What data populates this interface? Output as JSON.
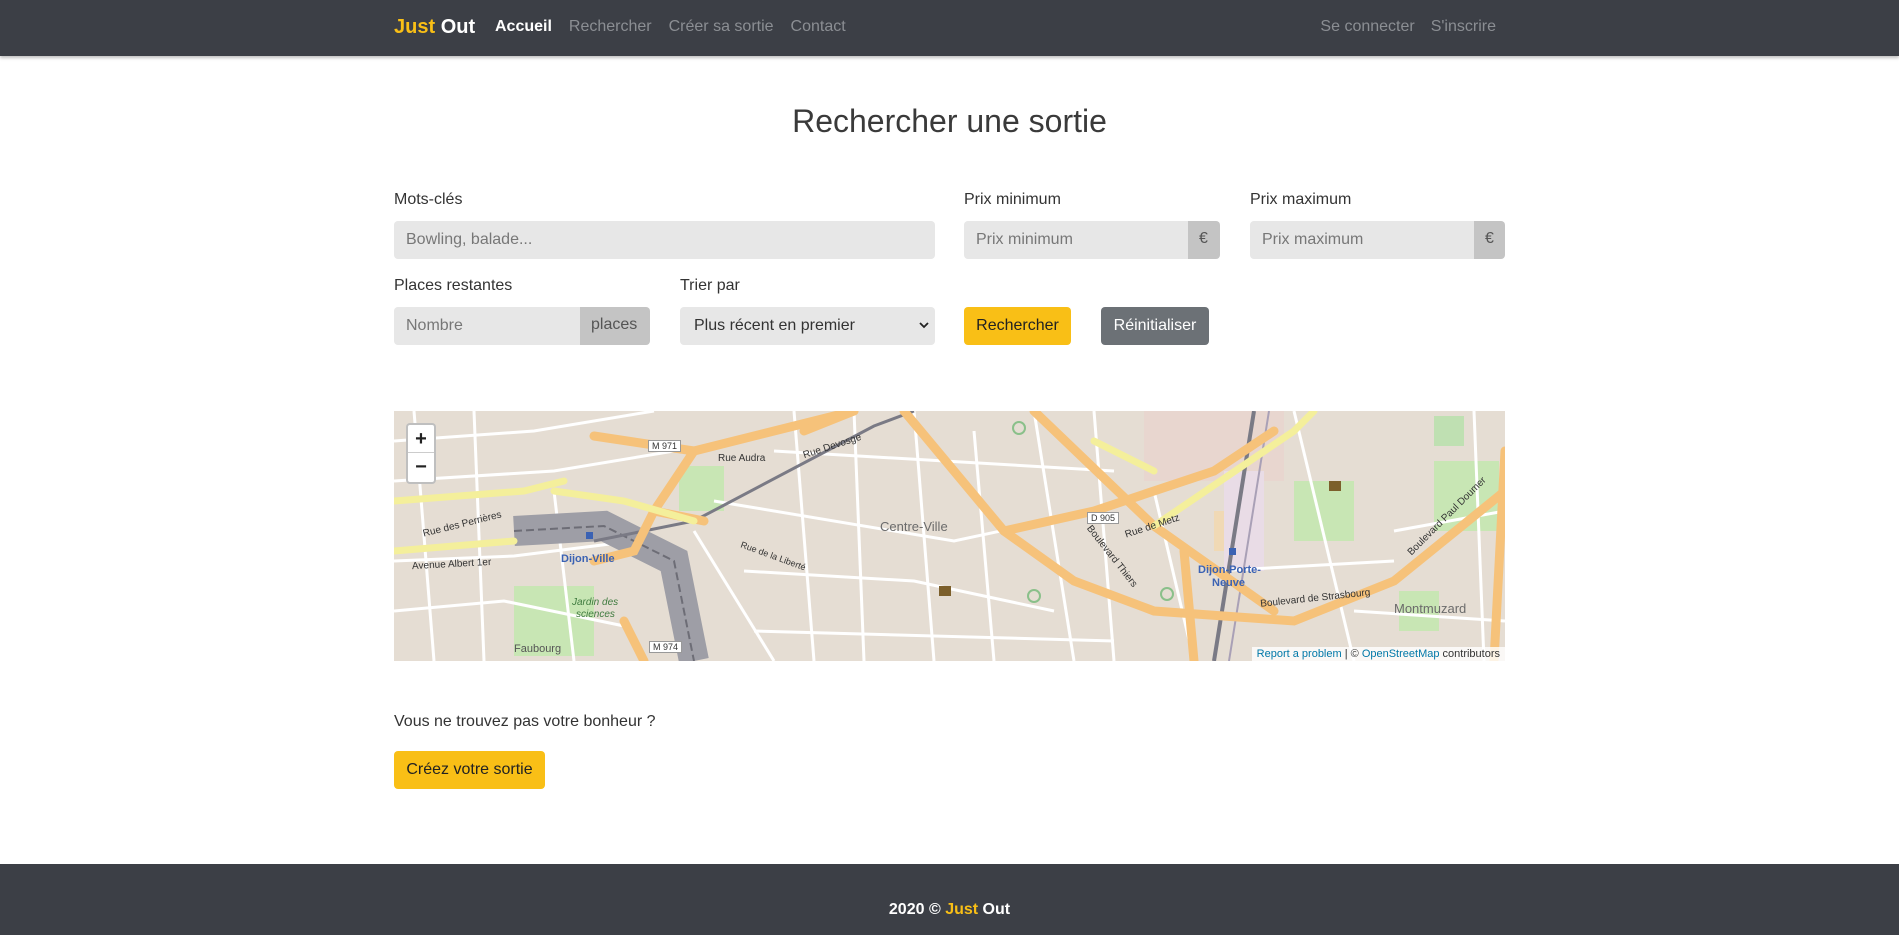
{
  "nav": {
    "brand_part1": "Just",
    "brand_part2": "Out",
    "links": [
      "Accueil",
      "Rechercher",
      "Créer sa sortie",
      "Contact"
    ],
    "right_links": [
      "Se connecter",
      "S'inscrire"
    ]
  },
  "page_title": "Rechercher une sortie",
  "form": {
    "keywords_label": "Mots-clés",
    "keywords_placeholder": "Bowling, balade...",
    "price_min_label": "Prix minimum",
    "price_min_placeholder": "Prix minimum",
    "price_max_label": "Prix maximum",
    "price_max_placeholder": "Prix maximum",
    "currency": "€",
    "places_label": "Places restantes",
    "places_placeholder": "Nombre",
    "places_addon": "places",
    "sort_label": "Trier par",
    "sort_selected": "Plus récent en premier",
    "search_button": "Rechercher",
    "reset_button": "Réinitialiser"
  },
  "map": {
    "zoom_in": "+",
    "zoom_out": "−",
    "attrib_report": "Report a problem",
    "attrib_sep": " | © ",
    "attrib_osm": "OpenStreetMap",
    "attrib_contrib": " contributors",
    "labels": {
      "centre": "Centre-Ville",
      "gare": "Dijon-Ville",
      "porte_neuve_1": "Dijon-Porte-",
      "porte_neuve_2": "Neuve",
      "montmuzard": "Montmuzard",
      "jardin_1": "Jardin des",
      "jardin_2": "sciences",
      "rue_audra": "Rue Audra",
      "rue_devosge": "Rue Devosge",
      "rue_metz": "Rue de Metz",
      "bd_thiers": "Boulevard Thiers",
      "bd_strasbourg": "Boulevard de Strasbourg",
      "bd_doumer": "Boulevard Paul Doumer",
      "av_albert": "Avenue Albert 1er",
      "rue_perrieres": "Rue des Perrières",
      "rue_liberte": "Rue de la Liberté",
      "faubourg": "Faubourg",
      "m971": "M 971",
      "m974": "M 974",
      "d905": "D 905"
    }
  },
  "not_found_text": "Vous ne trouvez pas votre bonheur ?",
  "create_button": "Créez votre sortie",
  "footer": {
    "prefix": "2020 © ",
    "brand_part1": "Just",
    "brand_part2": "Out"
  },
  "colors": {
    "navbar": "#3c3f46",
    "accent": "#f9bf16",
    "grey_button": "#6c7176"
  }
}
